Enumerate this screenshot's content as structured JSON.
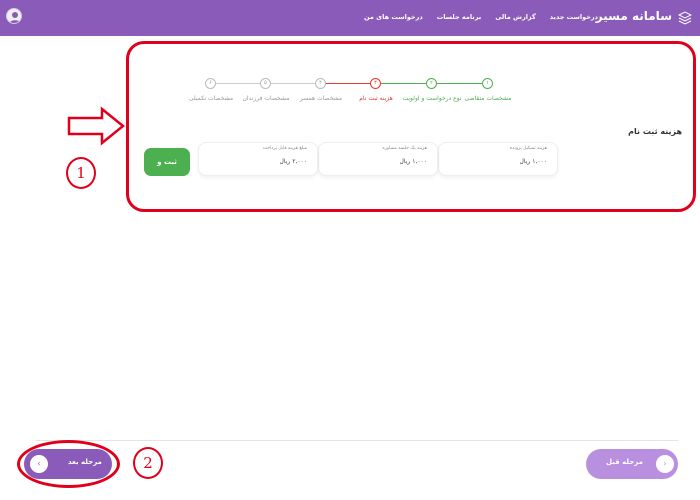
{
  "header": {
    "brand_title": "سامانه مسیر",
    "nav": [
      "درخواست های من",
      "برنامه جلسات",
      "گزارش مالی",
      "درخواست جدید"
    ],
    "brand_icon": "layers-logo-icon",
    "avatar_icon": "user-avatar-icon"
  },
  "stepper": {
    "steps": [
      {
        "num": "۱",
        "label": "مشخصات متقاضی",
        "state": "done"
      },
      {
        "num": "۲",
        "label": "نوع درخواست و اولویت",
        "state": "done"
      },
      {
        "num": "۳",
        "label": "هزینه ثبت نام",
        "state": "active"
      },
      {
        "num": "۴",
        "label": "مشخصات همسر",
        "state": "pending"
      },
      {
        "num": "۵",
        "label": "مشخصات فرزندان",
        "state": "pending"
      },
      {
        "num": "۶",
        "label": "مشخصات تکمیلی",
        "state": "pending"
      }
    ]
  },
  "section_title": "هزینه ثبت نام",
  "fees": [
    {
      "label": "هزینه تشکیل پرونده",
      "value": "۱,۰۰۰ ریال"
    },
    {
      "label": "هزینه یک جلسه مشاوره",
      "value": "۱,۰۰۰ ریال"
    },
    {
      "label": "مبلغ هزینه قابل پرداخت",
      "value": "۲,۰۰۰ ریال"
    }
  ],
  "pay_button": "ثبت و پرداخت",
  "footer": {
    "next_label": "مرحله بعد",
    "prev_label": "مرحله قبل"
  },
  "annotations": {
    "marker_1": "1",
    "marker_2": "2"
  },
  "colors": {
    "brand": "#8a5bb8",
    "done": "#4caf50",
    "active": "#e53935",
    "pending": "#bbbbbb",
    "annotation": "#e0001b"
  }
}
